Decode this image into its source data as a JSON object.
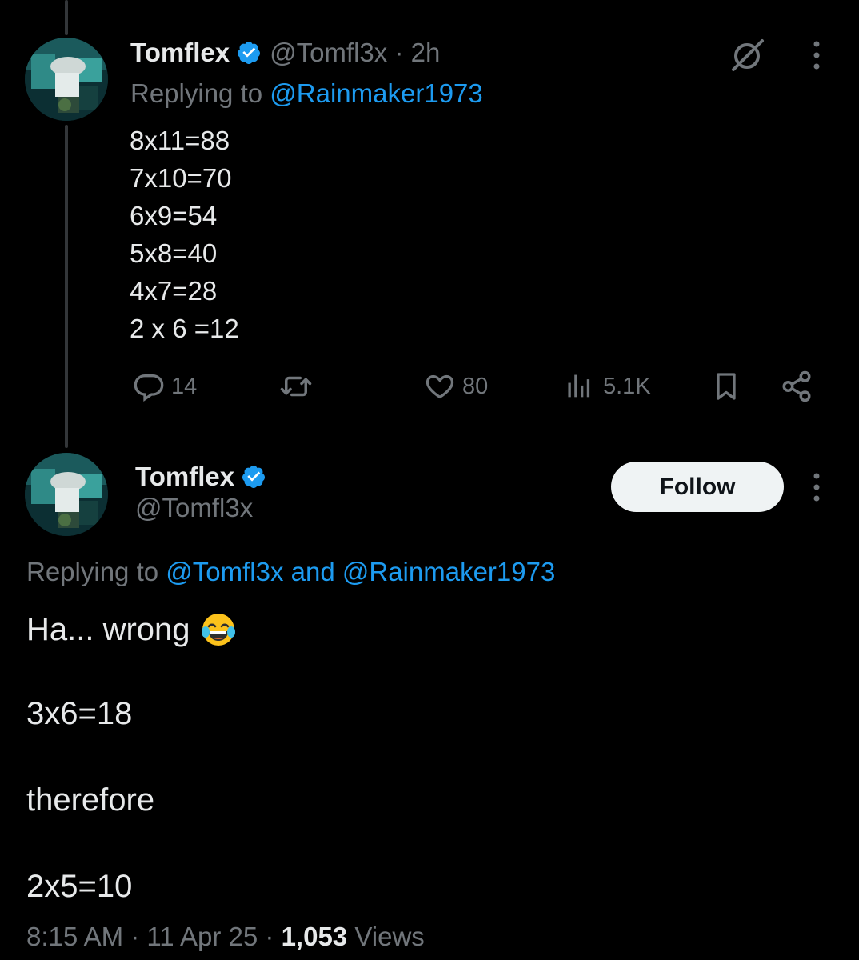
{
  "tweet1": {
    "author_name": "Tomflex",
    "handle": "@Tomfl3x",
    "separator": "·",
    "time": "2h",
    "replying_prefix": "Replying to",
    "replying_to": "@Rainmaker1973",
    "body_lines": [
      "8x11=88",
      "7x10=70",
      "6x9=54",
      "5x8=40",
      "4x7=28",
      "2 x 6 =12"
    ],
    "actions": {
      "replies": "14",
      "likes": "80",
      "views": "5.1K"
    }
  },
  "tweet2": {
    "author_name": "Tomflex",
    "handle": "@Tomfl3x",
    "follow_label": "Follow",
    "replying_prefix": "Replying to",
    "replying_to": "@Tomfl3x and @Rainmaker1973",
    "body": {
      "line1": "Ha... wrong",
      "line2": "3x6=18",
      "line3": "therefore",
      "line4": "2x5=10"
    },
    "timestamp": "8:15 AM · 11 Apr 25 ·",
    "views_count": "1,053",
    "views_label": "Views"
  },
  "icons": {
    "verified": "verified-badge-icon",
    "grok": "grok-icon",
    "more": "more-vertical-icon",
    "reply": "reply-icon",
    "retweet": "retweet-icon",
    "like": "heart-icon",
    "views": "views-icon",
    "bookmark": "bookmark-icon",
    "share": "share-icon",
    "emoji": "face-with-tears-of-joy-emoji"
  },
  "colors": {
    "background": "#000000",
    "text": "#e7e9ea",
    "muted": "#71767b",
    "link": "#1d9bf0",
    "verified": "#1d9bf0"
  }
}
